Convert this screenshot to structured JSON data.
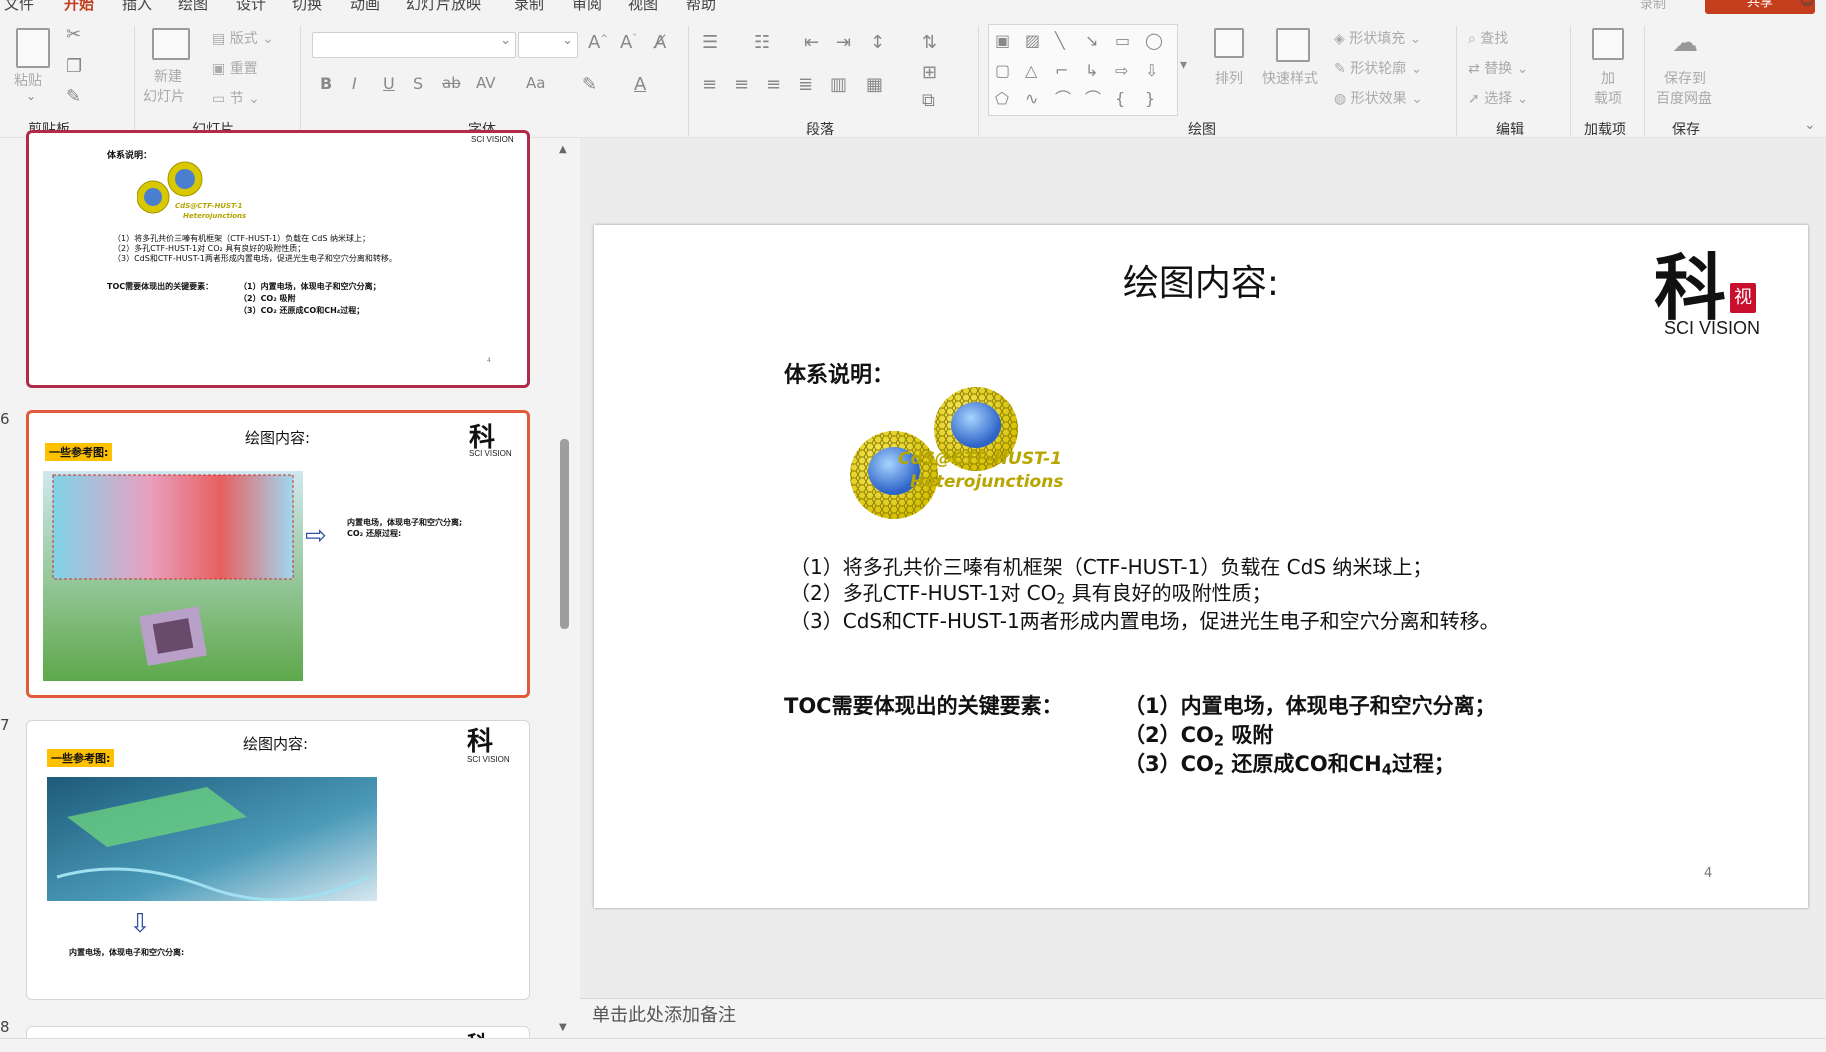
{
  "menu": {
    "tabs": [
      "文件",
      "开始",
      "插入",
      "绘图",
      "设计",
      "切换",
      "动画",
      "幻灯片放映",
      "录制",
      "审阅",
      "视图",
      "帮助"
    ],
    "active_tab": "开始",
    "record_label": "录制",
    "share_label": "共享"
  },
  "ribbon": {
    "clipboard": {
      "paste": "粘贴",
      "group": "剪贴板"
    },
    "slides": {
      "new_slide_line1": "新建",
      "new_slide_line2": "幻灯片",
      "layout": "版式",
      "reset": "重置",
      "section": "节",
      "group": "幻灯片"
    },
    "font": {
      "group": "字体"
    },
    "paragraph": {
      "group": "段落"
    },
    "drawing": {
      "arrange": "排列",
      "quick_styles": "快速样式",
      "shape_fill": "形状填充",
      "shape_outline": "形状轮廓",
      "shape_effects": "形状效果",
      "group": "绘图"
    },
    "editing": {
      "find": "查找",
      "replace": "替换",
      "select": "选择",
      "group": "编辑"
    },
    "addins": {
      "addin_line1": "加",
      "addin_line2": "载项",
      "group": "加载项"
    },
    "save": {
      "save_line1": "保存到",
      "save_line2": "百度网盘",
      "group": "保存"
    }
  },
  "thumbnails": {
    "slide5": {
      "head": "体系说明：",
      "bubble_label1": "CdS@CTF-HUST-1",
      "bubble_label2": "Heterojunctions",
      "l1": "（1）将多孔共价三嗪有机框架（CTF-HUST-1）负载在 CdS 纳米球上；",
      "l2": "（2）多孔CTF-HUST-1对 CO₂ 具有良好的吸附性质；",
      "l3": "（3）CdS和CTF-HUST-1两者形成内置电场，促进光生电子和空穴分离和转移。",
      "toc_label": "TOC需要体现出的关键要素：",
      "k1": "（1）内置电场，体现电子和空穴分离；",
      "k2": "（2）CO₂ 吸附",
      "k3": "（3）CO₂ 还原成CO和CH₄过程；",
      "page": "4",
      "logo_text": "SCI VISION"
    },
    "slide6": {
      "num": "6",
      "title": "绘图内容:",
      "tag": "一些参考图:",
      "note1": "内置电场，体现电子和空穴分离;",
      "note2": "CO₂ 还原过程:",
      "logo_text": "SCI VISION"
    },
    "slide7": {
      "num": "7",
      "title": "绘图内容:",
      "tag": "一些参考图:",
      "note1": "内置电场，体现电子和空穴分离:",
      "logo_text": "SCI VISION"
    },
    "slide8": {
      "num": "8"
    }
  },
  "slide": {
    "title": "绘图内容:",
    "head": "体系说明：",
    "bubble_label1": "CdS@CTF-HUST-1",
    "bubble_label2": "Heterojunctions",
    "line1": "（1）将多孔共价三嗪有机框架（CTF-HUST-1）负载在 CdS 纳米球上；",
    "line2_pre": "（2）多孔CTF-HUST-1对 CO",
    "line2_sub": "2",
    "line2_post": " 具有良好的吸附性质；",
    "line3": "（3）CdS和CTF-HUST-1两者形成内置电场，促进光生电子和空穴分离和转移。",
    "toc_label": "TOC需要体现出的关键要素：",
    "key1": "（1）内置电场，体现电子和空穴分离；",
    "key2_pre": "（2）CO",
    "key2_sub": "2",
    "key2_post": " 吸附",
    "key3_pre": "（3）CO",
    "key3_sub": "2",
    "key3_mid": " 还原成CO和CH",
    "key3_sub2": "4",
    "key3_post": "过程；",
    "page_number": "4",
    "logo_char": "科",
    "logo_seal": "视",
    "logo_text": "SCI VISION"
  },
  "notes": {
    "placeholder": "单击此处添加备注"
  },
  "colors": {
    "accent": "#c43e1c",
    "selected_thumb": "#e05a3c",
    "logo_red": "#c8102e",
    "tag_yellow": "#ffc000"
  }
}
